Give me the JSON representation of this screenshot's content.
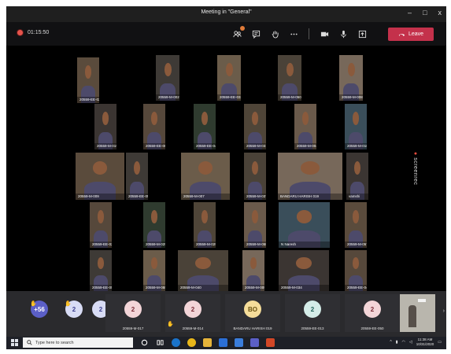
{
  "window": {
    "title": "Meeting in \"General\"",
    "controls": {
      "minimize": "–",
      "maximize": "□",
      "close": "x"
    }
  },
  "toolbar": {
    "timer": "01:15:50",
    "leave_label": "Leave",
    "icons": [
      "participants-icon",
      "chat-icon",
      "raise-hand-icon",
      "more-icon",
      "camera-icon",
      "mic-icon",
      "share-icon"
    ],
    "colors": {
      "leave": "#c4314b",
      "record": "#e5534b"
    }
  },
  "stage": {
    "tiles": [
      {
        "label": "20559-EE-026"
      },
      {
        "label": "20559-M-002"
      },
      {
        "label": "20559-EE-032"
      },
      {
        "label": "20559-M-050"
      },
      {
        "label": "20559-M-008"
      },
      {
        "label": "20559-M-019"
      },
      {
        "label": "20559-EE-002"
      },
      {
        "label": "20559-EE-043"
      },
      {
        "label": "20559-M-031"
      },
      {
        "label": "20559-M-004"
      },
      {
        "label": "20559-M-018"
      },
      {
        "label": "20559-M-009"
      },
      {
        "label": "20559-EE-054"
      },
      {
        "label": "20559-M-007"
      },
      {
        "label": "20559-M-037"
      },
      {
        "label": "BANDARU HARISH 019"
      },
      {
        "label": "vamshi"
      },
      {
        "label": "20559-EE-024"
      },
      {
        "label": "20559-M-025"
      },
      {
        "label": "20559-M-029"
      },
      {
        "label": "20559-M-058"
      },
      {
        "label": "N Naresh"
      },
      {
        "label": "20559-M-057"
      },
      {
        "label": "20559-EE-050"
      },
      {
        "label": "20559-M-055"
      },
      {
        "label": "20559-M-040"
      },
      {
        "label": "20559-M-009"
      },
      {
        "label": "20559-M-034"
      },
      {
        "label": "20559-EE-045"
      }
    ],
    "watermark": "screenrec"
  },
  "roster": {
    "items": [
      {
        "initials": "+56",
        "name": "",
        "bg": "#5b5fc7",
        "fg": "#ffffff"
      },
      {
        "initials": "2",
        "name": "",
        "bg": "#d8dcf5",
        "fg": "#3b3f8f"
      },
      {
        "initials": "2",
        "name": "",
        "bg": "#d8dcf5",
        "fg": "#3b3f8f"
      },
      {
        "initials": "2",
        "name": "20559-M-017",
        "bg": "#f3d5d8",
        "fg": "#7a2b36"
      },
      {
        "initials": "2",
        "name": "20559-M-014",
        "bg": "#f3d5d8",
        "fg": "#7a2b36"
      },
      {
        "initials": "BO",
        "name": "BANDARU HARISH 019",
        "bg": "#f5dd9a",
        "fg": "#6a5210"
      },
      {
        "initials": "2",
        "name": "20559-EE-013",
        "bg": "#d4ece8",
        "fg": "#20615a"
      },
      {
        "initials": "2",
        "name": "20559-EE-050",
        "bg": "#f3d5d8",
        "fg": "#7a2b36"
      }
    ]
  },
  "taskbar": {
    "search_placeholder": "Type here to search",
    "time": "11:38 AM",
    "date": "10/31/2020",
    "apps": [
      "cortana-icon",
      "task-view-icon",
      "edge-icon",
      "chrome-icon",
      "explorer-icon",
      "store-icon",
      "mail-icon",
      "teams-icon",
      "office-icon"
    ]
  }
}
